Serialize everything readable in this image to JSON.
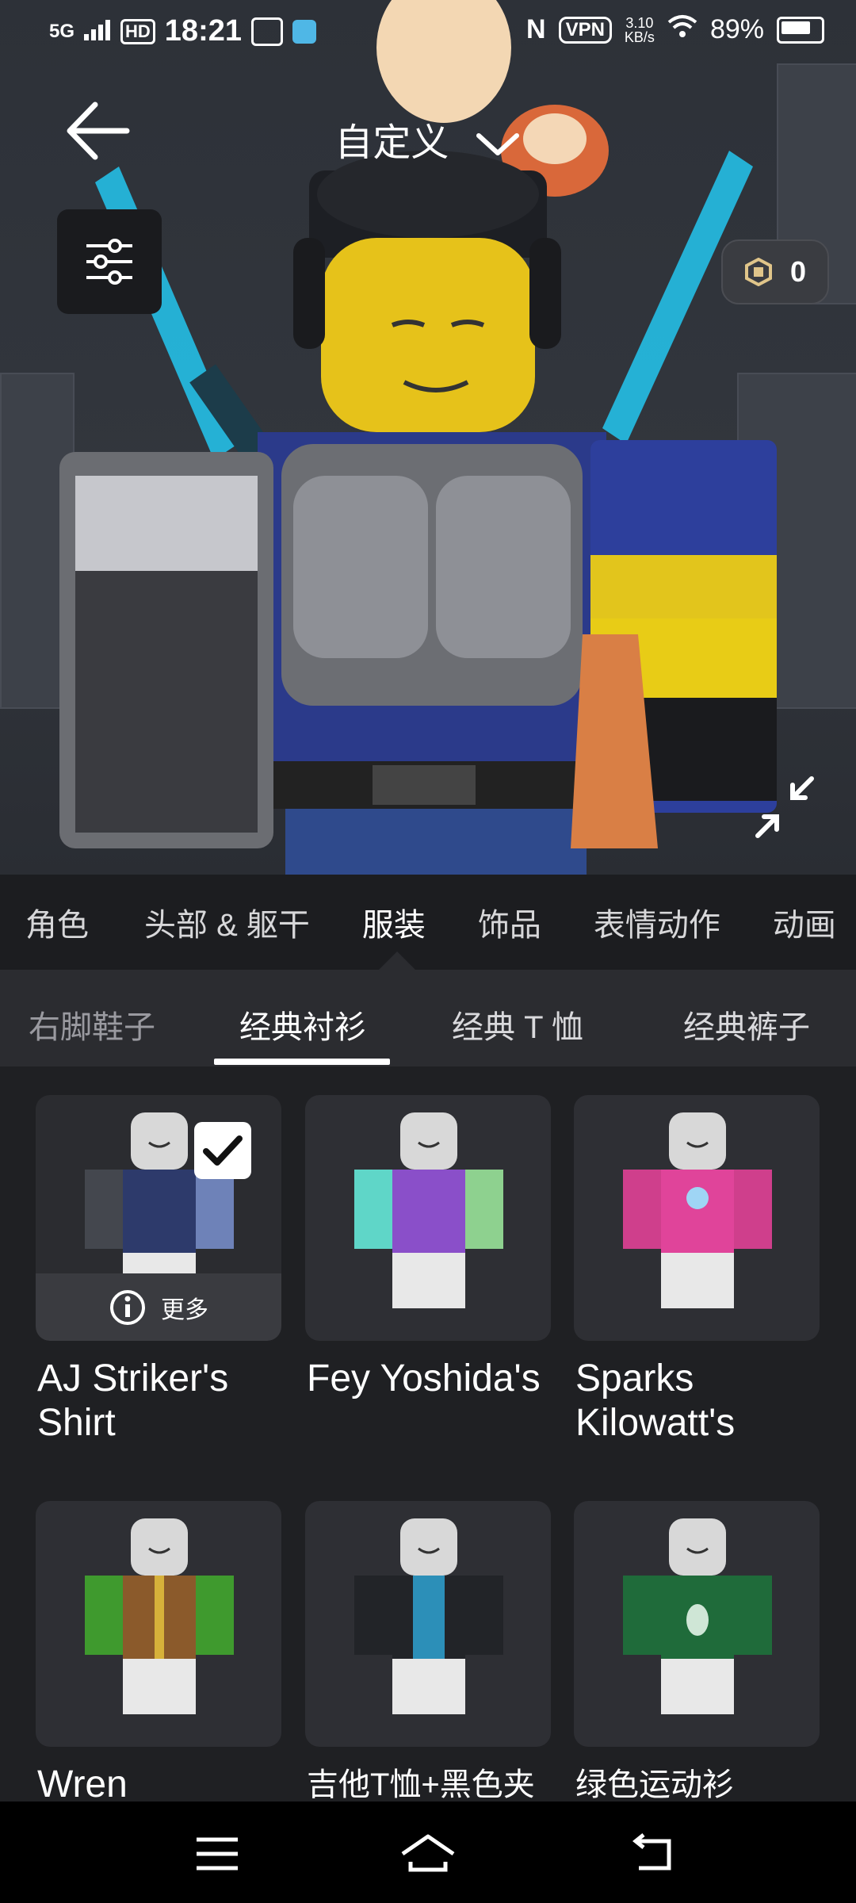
{
  "status_bar": {
    "network": "5G",
    "hd": "HD",
    "time": "18:21",
    "vpn": "VPN",
    "speed_top": "3.10",
    "speed_bottom": "KB/s",
    "battery": "89%"
  },
  "header": {
    "title": "自定义"
  },
  "robux": {
    "balance": "0"
  },
  "category_tabs": [
    {
      "label": "角色",
      "active": false
    },
    {
      "label": "头部 & 躯干",
      "active": false
    },
    {
      "label": "服装",
      "active": true
    },
    {
      "label": "饰品",
      "active": false
    },
    {
      "label": "表情动作",
      "active": false
    },
    {
      "label": "动画",
      "active": false
    }
  ],
  "sub_tabs": [
    {
      "label": "右脚鞋子",
      "active": false
    },
    {
      "label": "经典衬衫",
      "active": true
    },
    {
      "label": "经典 T 恤",
      "active": false
    },
    {
      "label": "经典裤子",
      "active": false
    }
  ],
  "items": [
    {
      "name": "AJ Striker's Shirt",
      "selected": true,
      "more_label": "更多",
      "shirt_color": "#2d3a6b"
    },
    {
      "name": "Fey Yoshida's",
      "selected": false,
      "shirt_color": "#8a4fc9"
    },
    {
      "name": "Sparks Kilowatt's",
      "selected": false,
      "shirt_color": "#e0449a"
    },
    {
      "name": "Wren",
      "selected": false,
      "shirt_color": "#3f9a2e"
    },
    {
      "name": "吉他T恤+黑色夹",
      "selected": false,
      "shirt_color": "#222428"
    },
    {
      "name": "绿色运动衫",
      "selected": false,
      "shirt_color": "#1f6b3a"
    }
  ],
  "colors": {
    "background": "#1f2023",
    "accent": "#ffffff",
    "avatar_head": "#e6c21a",
    "cyan_glow": "#23c7f0"
  }
}
